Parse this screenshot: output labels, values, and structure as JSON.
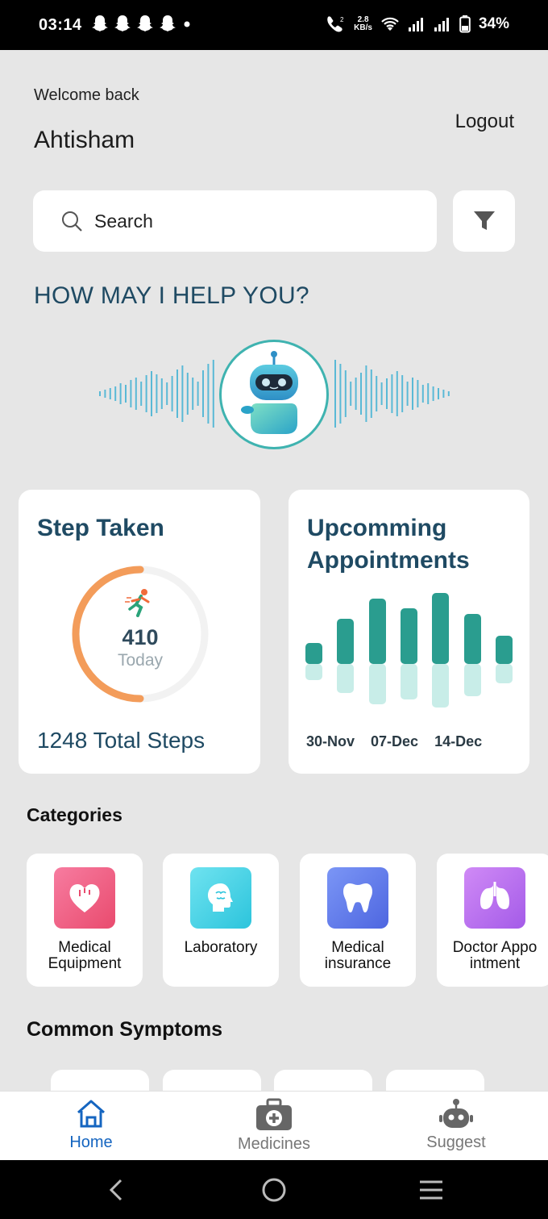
{
  "status_bar": {
    "time": "03:14",
    "net_speed_value": "2.8",
    "net_speed_unit": "KB/s",
    "battery": "34%"
  },
  "header": {
    "welcome": "Welcome back",
    "username": "Ahtisham",
    "logout": "Logout"
  },
  "search": {
    "placeholder": "Search"
  },
  "assistant": {
    "heading": "HOW MAY I HELP YOU?"
  },
  "steps_card": {
    "title": "Step Taken",
    "today_value": "410",
    "today_label": "Today",
    "today_progress": 0.5,
    "total": "1248 Total Steps"
  },
  "appointments_card": {
    "title_line1": "Upcomming",
    "title_line2": "Appointments",
    "date_labels": [
      "30-Nov",
      "07-Dec",
      "14-Dec"
    ]
  },
  "categories": {
    "title": "Categories",
    "items": [
      {
        "label": "Medical Equipment",
        "icon": "heart-icon",
        "color": "#f25f86"
      },
      {
        "label": "Laboratory",
        "icon": "brain-icon",
        "color": "#3fd3e6"
      },
      {
        "label": "Medical insurance",
        "icon": "tooth-icon",
        "color": "#5b7bf0"
      },
      {
        "label": "Doctor Appo intment",
        "icon": "lungs-icon",
        "color": "#b66cf2"
      }
    ]
  },
  "symptoms": {
    "title": "Common Symptoms"
  },
  "bottom_nav": {
    "items": [
      {
        "label": "Home",
        "icon": "home-icon",
        "active": true
      },
      {
        "label": "Medicines",
        "icon": "medkit-icon",
        "active": false
      },
      {
        "label": "Suggest",
        "icon": "robot-icon",
        "active": false
      }
    ]
  },
  "colors": {
    "accent_teal": "#2a9d8f",
    "heading_navy": "#1f4a63",
    "nav_active": "#1565c0",
    "ring_orange": "#f39c5a"
  }
}
